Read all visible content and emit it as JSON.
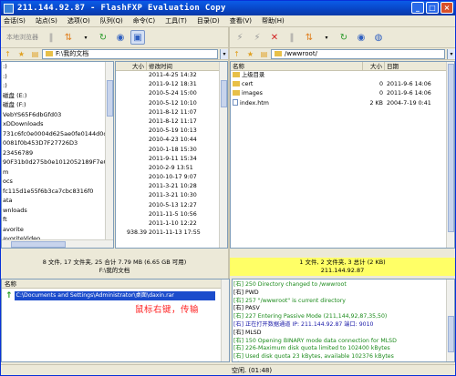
{
  "window": {
    "title": "211.144.92.87 - FlashFXP Evaluation Copy"
  },
  "menu": [
    "会话(S)",
    "站点(S)",
    "选项(O)",
    "队列(Q)",
    "命令(C)",
    "工具(T)",
    "目录(D)",
    "查看(V)",
    "帮助(H)"
  ],
  "left_toolbar": {
    "text_button": "本地浏览器"
  },
  "left_path": "F:\\我的文档",
  "right_path": "/wwwroot/",
  "tree_items": [
    ":)",
    ":)",
    ":)",
    "磁盘 (E:)",
    "磁盘 (F:)",
    "VebYS65F6dbGfd03",
    "xDDownloads",
    "731c6fc0e0004d625ae0fe0144d0d2",
    "0081f0b453D7F27726D3",
    "23456789",
    "90F31b0d275b0e1012052189F7e0f4",
    "m",
    "ocs",
    "fc115d1e55f6b3ca7cbc8316f0",
    "ata",
    "wnloads",
    "ft",
    "avorite",
    "avoriteVideo"
  ],
  "local_list": {
    "columns": [
      "大小",
      "修改时间"
    ],
    "dates": [
      "2011-4-25 14:32",
      "2011-9-12 18:31",
      "2010-5-24 15:00",
      "2010-5-12 10:10",
      "2011-8-12 11:07",
      "2011-8-12 11:17",
      "2010-5-19 10:13",
      "2010-4-23 10:44",
      "2010-1-18 15:30",
      "2011-9-11 15:34",
      "2010-2-9 13:51",
      "2010-10-17 9:07",
      "2011-3-21 10:28",
      "2011-3-21 10:30",
      "2010-5-13 12:27",
      "2011-11-5 10:56",
      "2011-1-10 12:22",
      "2011-11-13 17:55"
    ],
    "partial_size": "938.39"
  },
  "remote_list": {
    "columns": [
      "名称",
      "大小",
      "日期"
    ],
    "rows": [
      {
        "name": "上级目录",
        "size": "",
        "date": "",
        "icon": "parent-folder"
      },
      {
        "name": "cert",
        "size": "0",
        "date": "2011-9-6 14:06",
        "icon": "folder"
      },
      {
        "name": "images",
        "size": "0",
        "date": "2011-9-6 14:06",
        "icon": "folder"
      },
      {
        "name": "index.htm",
        "size": "2 KB",
        "date": "2004-7-19 0:41",
        "icon": "file"
      }
    ]
  },
  "status_left": {
    "line1": "8 文件, 17 文件夹, 25 合计 7.79 MB (6.65 GB 可用)",
    "line2": "F:\\我的文档"
  },
  "status_right": {
    "line1": "1 文件, 2 文件夹, 3 总计 (2 KB)",
    "line2": "211.144.92.87"
  },
  "queue": {
    "header": "名称",
    "item": "C:\\Documents and Settings\\Administrator\\桌面\\daxin.rar",
    "annotation": "鼠标右键，传输"
  },
  "log": [
    {
      "text": "[右] 250 Directory changed to /wwwroot",
      "tone": "green"
    },
    {
      "text": "[右] PWD",
      "tone": "black"
    },
    {
      "text": "[右] 257 \"/wwwroot\" is current directory",
      "tone": "green"
    },
    {
      "text": "[右] PASV",
      "tone": "black"
    },
    {
      "text": "[右] 227 Entering Passive Mode (211,144,92,87,35,50)",
      "tone": "green"
    },
    {
      "text": "[右] 正在打开数据通道 IP: 211.144.92.87 端口: 9010",
      "tone": "blue"
    },
    {
      "text": "[右] MLSD",
      "tone": "black"
    },
    {
      "text": "[右] 150 Opening BINARY mode data connection for MLSD",
      "tone": "green"
    },
    {
      "text": "[右] 226-Maximum disk quota limited to 102400 kBytes",
      "tone": "green"
    },
    {
      "text": "[右]     Used disk quota 23 kBytes, available 102376 kBytes",
      "tone": "green"
    },
    {
      "text": "[右] 226 Transfer complete",
      "tone": "green"
    },
    {
      "text": "[右] 列表完成: 247 字节 于 0.43 秒 (0.5 KB/秒)",
      "tone": "blue"
    }
  ],
  "bottom_status": "空闲. (01:48)"
}
